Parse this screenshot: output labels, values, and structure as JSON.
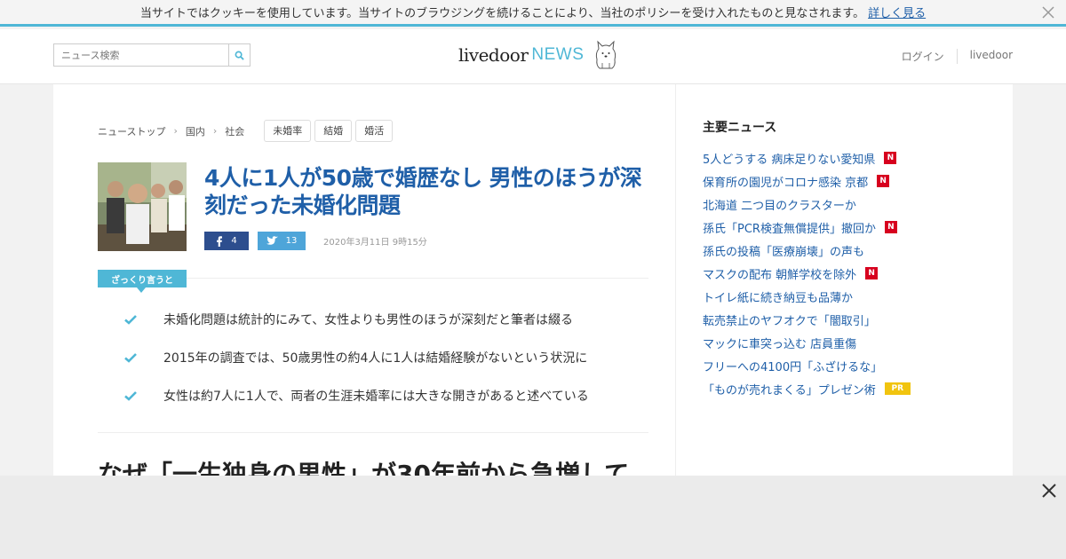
{
  "cookie": {
    "message": "当サイトではクッキーを使用しています。当サイトのブラウジングを続けることにより、当社のポリシーを受け入れたものと見なされます。",
    "link": "詳しく見る"
  },
  "header": {
    "search_placeholder": "ニュース検索",
    "logo_brand": "livedoor",
    "logo_news": "NEWS",
    "login": "ログイン",
    "livedoor": "livedoor"
  },
  "breadcrumb": [
    "ニューストップ",
    "国内",
    "社会"
  ],
  "tags": [
    "未婚率",
    "結婚",
    "婚活"
  ],
  "article": {
    "title": "4人に1人が50歳で婚歴なし 男性のほうが深刻だった未婚化問題",
    "facebook_count": "4",
    "twitter_count": "13",
    "date": "2020年3月11日 9時15分",
    "summary_label": "ざっくり言うと",
    "summary": [
      "未婚化問題は統計的にみて、女性よりも男性のほうが深刻だと筆者は綴る",
      "2015年の調査では、50歳男性の約4人に1人は結婚経験がないという状況に",
      "女性は約7人に1人で、両者の生涯未婚率には大きな開きがあると述べている"
    ],
    "subheading": "なぜ「一生独身の男性」が30年前から急増して"
  },
  "sidebar": {
    "title": "主要ニュース",
    "items": [
      {
        "text": "5人どうする 病床足りない愛知県",
        "badge": "N"
      },
      {
        "text": "保育所の園児がコロナ感染 京都",
        "badge": "N"
      },
      {
        "text": "北海道 二つ目のクラスターか",
        "badge": ""
      },
      {
        "text": "孫氏「PCR検査無償提供」撤回か",
        "badge": "N"
      },
      {
        "text": "孫氏の投稿「医療崩壊」の声も",
        "badge": ""
      },
      {
        "text": "マスクの配布 朝鮮学校を除外",
        "badge": "N"
      },
      {
        "text": "トイレ紙に続き納豆も品薄か",
        "badge": ""
      },
      {
        "text": "転売禁止のヤフオクで「闇取引」",
        "badge": ""
      },
      {
        "text": "マックに車突っ込む 店員重傷",
        "badge": ""
      },
      {
        "text": "フリーへの4100円「ふざけるな」",
        "badge": ""
      },
      {
        "text": "「ものが売れまくる」プレゼン術",
        "badge": "PR"
      }
    ]
  },
  "colors": {
    "accent": "#4fb7d6",
    "link": "#1f5fa8",
    "badge_new": "#d7001e",
    "badge_pr": "#f1c40f",
    "facebook": "#2d4e8e",
    "twitter": "#4ea5d9"
  }
}
